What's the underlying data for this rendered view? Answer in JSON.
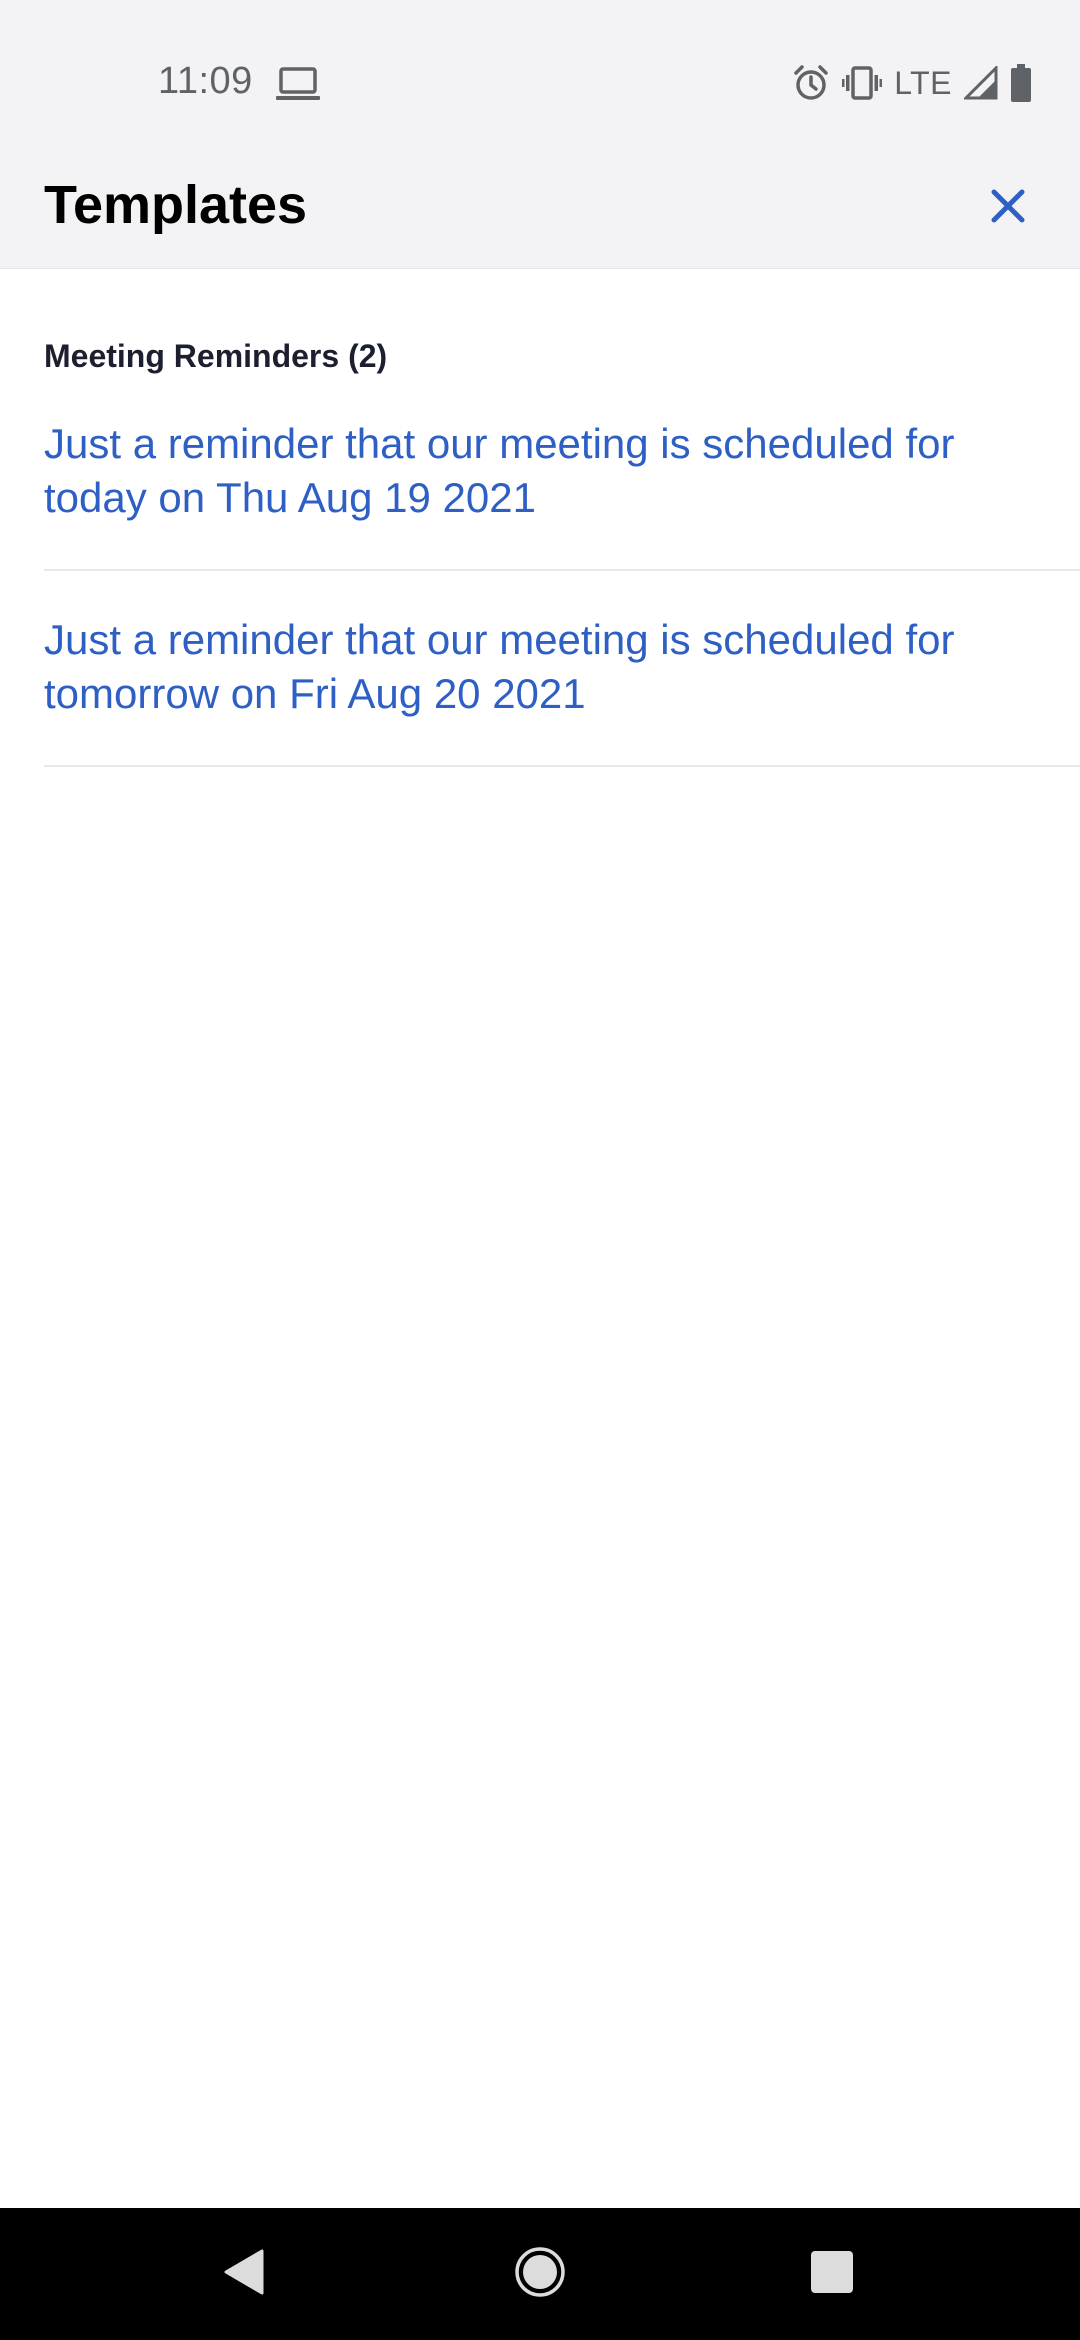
{
  "status_bar": {
    "time": "11:09",
    "network": "LTE",
    "icons": [
      "laptop-icon",
      "alarm-icon",
      "vibrate-icon",
      "signal-icon",
      "battery-icon"
    ]
  },
  "header": {
    "title": "Templates",
    "close_icon": "close-icon",
    "accent_color": "#2e5fc4"
  },
  "section": {
    "title": "Meeting Reminders (2)",
    "items": [
      {
        "text": "Just a reminder that our meeting is scheduled for today on Thu Aug 19 2021"
      },
      {
        "text": "Just a reminder that our meeting is scheduled for tomorrow on Fri Aug 20 2021"
      }
    ]
  },
  "nav_bar": {
    "icons": [
      "back-icon",
      "home-icon",
      "recents-icon"
    ]
  }
}
